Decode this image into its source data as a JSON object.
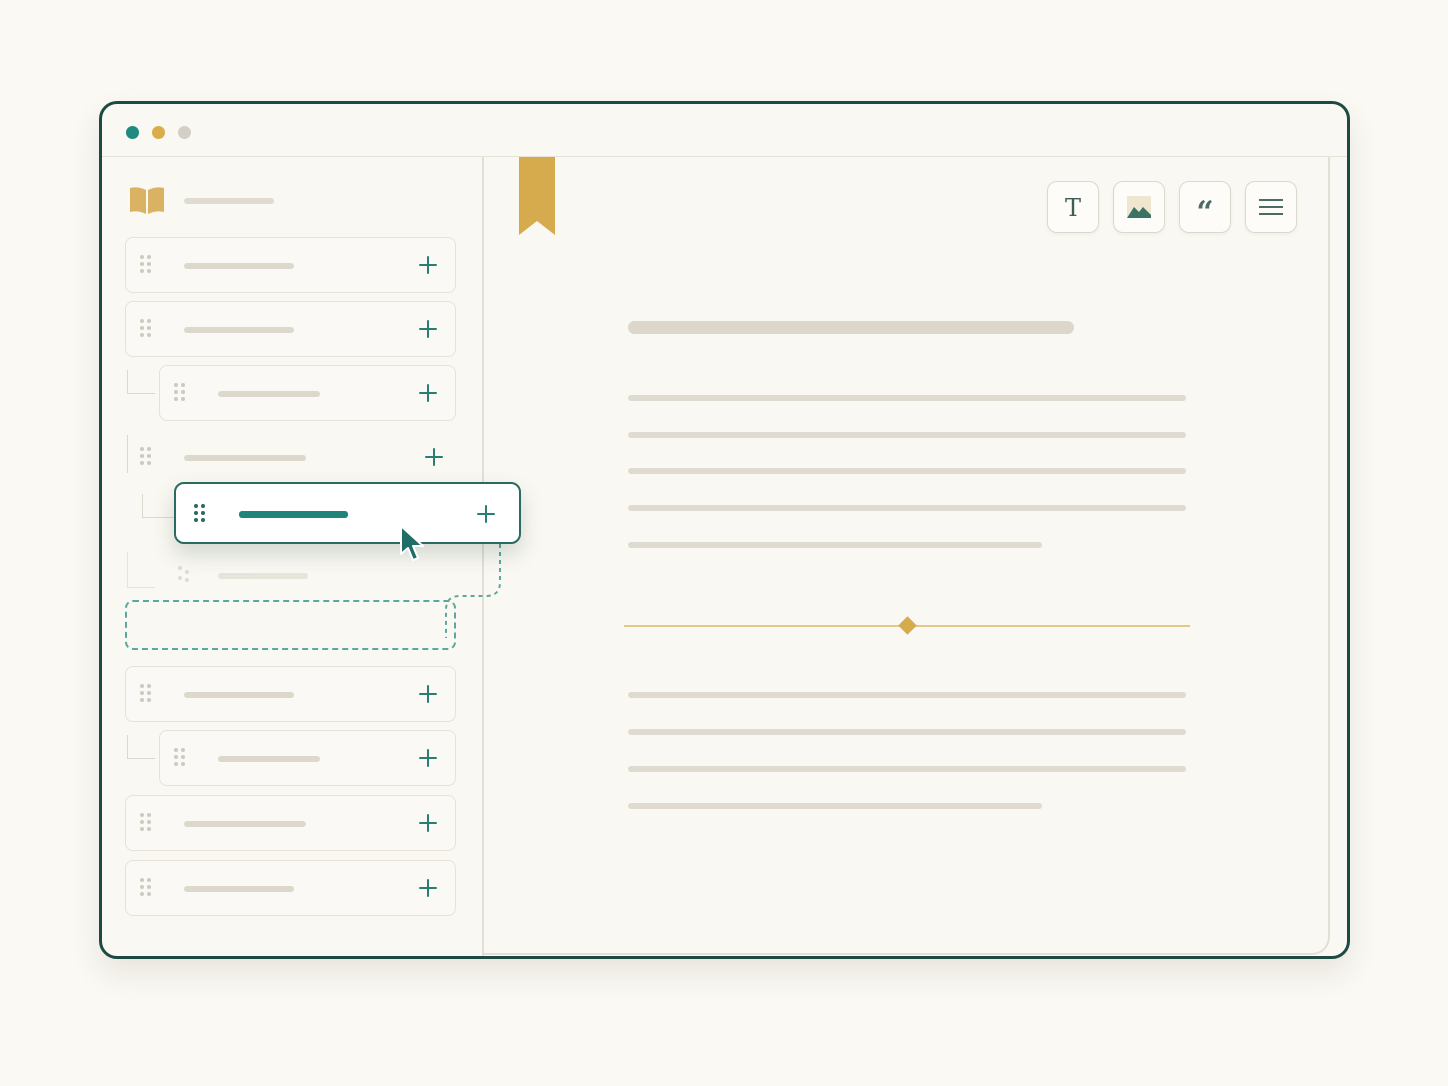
{
  "window": {
    "traffic_lights": [
      "#1f8a80",
      "#d9ad49",
      "#d3cfc6"
    ]
  },
  "sidebar": {
    "logo_icon": "open-book-icon",
    "items": [
      {
        "level": 0,
        "fill": 0.55
      },
      {
        "level": 0,
        "fill": 0.5
      },
      {
        "level": 1,
        "fill": 0.5
      },
      {
        "level": 0,
        "fill": 0.55,
        "state": "plain"
      },
      {
        "level": 1,
        "state": "dragging"
      },
      {
        "level": 1,
        "state": "ghost"
      },
      {
        "level": 0,
        "state": "drop-target"
      },
      {
        "level": 0,
        "fill": 0.5
      },
      {
        "level": 1,
        "fill": 0.5
      },
      {
        "level": 0,
        "fill": 0.55
      },
      {
        "level": 0,
        "fill": 0.5
      }
    ]
  },
  "toolbar": {
    "tools": [
      {
        "name": "text-tool",
        "glyph": "T"
      },
      {
        "name": "image-tool",
        "glyph": ""
      },
      {
        "name": "quote-tool",
        "glyph": "“"
      },
      {
        "name": "list-tool",
        "glyph": ""
      }
    ]
  },
  "colors": {
    "accent": "#1f8479",
    "frame": "#1d4a42",
    "gold": "#d6ab4d",
    "placeholder": "#dfdbd0"
  }
}
